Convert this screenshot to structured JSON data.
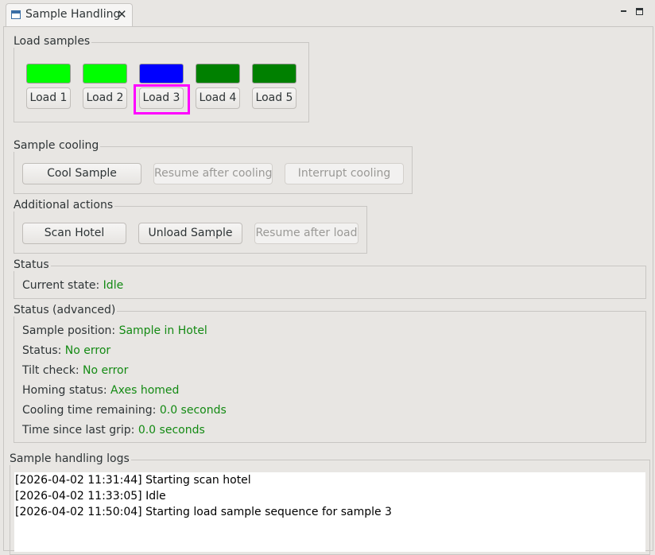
{
  "view": {
    "title": "Sample Handling"
  },
  "load_samples": {
    "title": "Load samples",
    "slots": [
      {
        "label": "Load 1",
        "color": "#00ff00"
      },
      {
        "label": "Load 2",
        "color": "#00ff00"
      },
      {
        "label": "Load 3",
        "color": "#0000ff"
      },
      {
        "label": "Load 4",
        "color": "#008000"
      },
      {
        "label": "Load 5",
        "color": "#008000"
      }
    ],
    "highlight_color": "#ff00ff"
  },
  "sample_cooling": {
    "title": "Sample cooling",
    "cool_label": "Cool Sample",
    "resume_label": "Resume after cooling",
    "interrupt_label": "Interrupt cooling"
  },
  "additional_actions": {
    "title": "Additional actions",
    "scan_label": "Scan Hotel",
    "unload_label": "Unload Sample",
    "resume_load_label": "Resume after load"
  },
  "status": {
    "title": "Status",
    "current_state_label": "Current state:",
    "current_state_value": "Idle"
  },
  "status_advanced": {
    "title": "Status (advanced)",
    "rows": [
      {
        "label": "Sample position:",
        "value": "Sample in Hotel"
      },
      {
        "label": "Status:",
        "value": "No error"
      },
      {
        "label": "Tilt check:",
        "value": "No error"
      },
      {
        "label": "Homing status:",
        "value": "Axes homed"
      },
      {
        "label": "Cooling time remaining:",
        "value": "0.0 seconds"
      },
      {
        "label": "Time since last grip:",
        "value": "0.0 seconds"
      }
    ]
  },
  "logs": {
    "title": "Sample handling logs",
    "lines": [
      "[2026-04-02 11:31:44] Starting scan hotel",
      "[2026-04-02 11:33:05] Idle",
      "[2026-04-02 11:50:04] Starting load sample sequence for sample 3"
    ]
  },
  "colors": {
    "value_green": "#138a13"
  }
}
